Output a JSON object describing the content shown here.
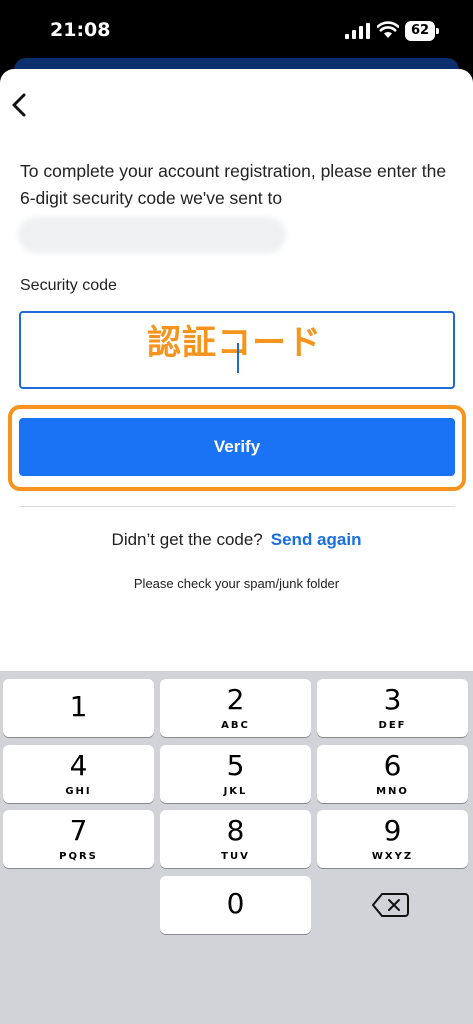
{
  "status_bar": {
    "time": "21:08",
    "battery": "62"
  },
  "content": {
    "instructions": "To complete your account registration, please enter the 6-digit security code we've sent to",
    "field_label": "Security code",
    "input_overlay": "認証コード",
    "verify_label": "Verify",
    "resend_prompt": "Didn’t get the code?",
    "resend_link": "Send again",
    "spam_note": "Please check your spam/junk folder"
  },
  "keypad": {
    "keys": [
      {
        "digit": "1",
        "letters": ""
      },
      {
        "digit": "2",
        "letters": "ABC"
      },
      {
        "digit": "3",
        "letters": "DEF"
      },
      {
        "digit": "4",
        "letters": "GHI"
      },
      {
        "digit": "5",
        "letters": "JKL"
      },
      {
        "digit": "6",
        "letters": "MNO"
      },
      {
        "digit": "7",
        "letters": "PQRS"
      },
      {
        "digit": "8",
        "letters": "TUV"
      },
      {
        "digit": "9",
        "letters": "WXYZ"
      },
      {
        "digit": "0",
        "letters": ""
      }
    ]
  },
  "colors": {
    "accent": "#1a73f5",
    "highlight": "#f7941d",
    "link": "#1a6fe0"
  }
}
